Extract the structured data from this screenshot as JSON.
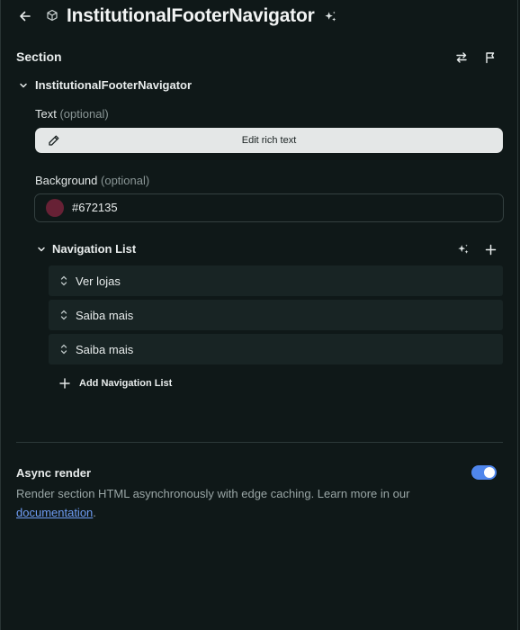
{
  "header": {
    "title": "InstitutionalFooterNavigator",
    "icons": {
      "back": "arrow-left-icon",
      "component": "cube-icon",
      "ai": "sparkles-icon"
    }
  },
  "section": {
    "label": "Section",
    "icons": {
      "swap": "swap-arrows-icon",
      "flag": "flag-icon"
    }
  },
  "tree": {
    "label": "InstitutionalFooterNavigator"
  },
  "text_field": {
    "label": "Text",
    "optional": "(optional)",
    "button_label": "Edit rich text"
  },
  "background_field": {
    "label": "Background",
    "optional": "(optional)",
    "value": "#672135",
    "swatch_color": "#672135"
  },
  "navigation_list": {
    "label": "Navigation List",
    "items": [
      {
        "label": "Ver lojas"
      },
      {
        "label": "Saiba mais"
      },
      {
        "label": "Saiba mais"
      }
    ],
    "add_label": "Add Navigation List"
  },
  "async_render": {
    "title": "Async render",
    "description": "Render section HTML asynchronously with edge caching. Learn more in our",
    "link_text": "documentation",
    "suffix": ".",
    "enabled": true,
    "toggle_color": "#4f86ec"
  },
  "colors": {
    "background": "#0f1818",
    "item_background": "#182424",
    "accent": "#4f86ec"
  }
}
